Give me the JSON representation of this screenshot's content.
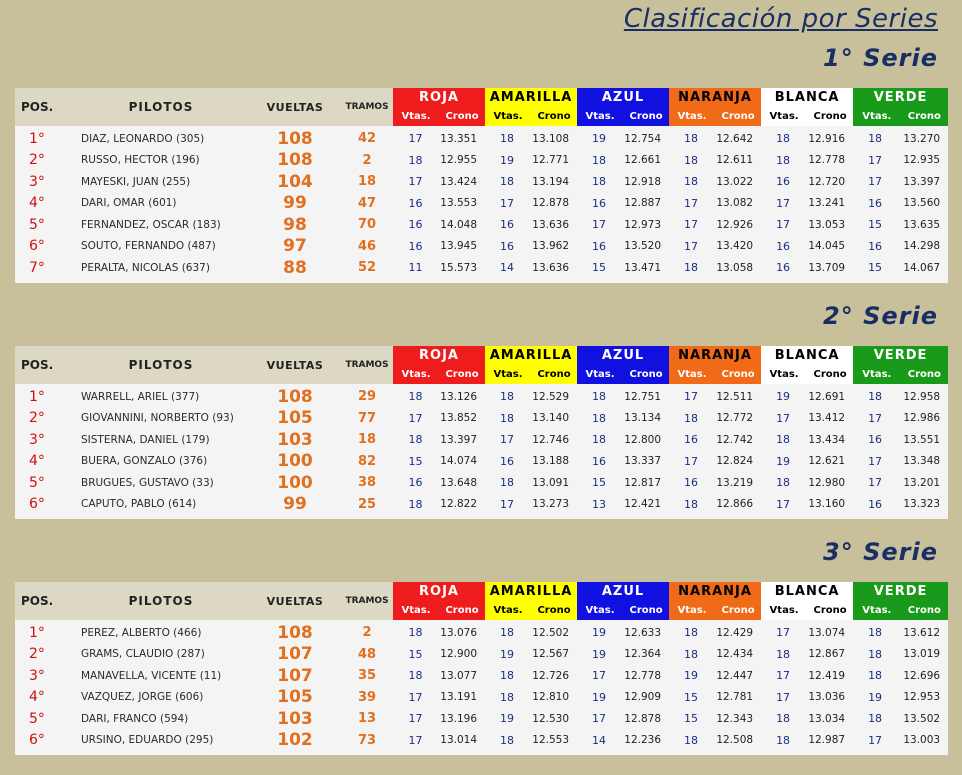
{
  "title": "Clasificación por Series",
  "headers": {
    "pos": "POS.",
    "pilotos": "PILOTOS",
    "vueltas": "VUELTAS",
    "tramos": "TRAMOS",
    "vtas": "Vtas.",
    "crono": "Crono"
  },
  "lanes": [
    {
      "name": "ROJA",
      "bg": "#ee1c1c",
      "fg": "#ffffff",
      "subfg": "#ffffff"
    },
    {
      "name": "AMARILLA",
      "bg": "#ffff00",
      "fg": "#000000",
      "subfg": "#000000"
    },
    {
      "name": "AZUL",
      "bg": "#1010e0",
      "fg": "#ffffff",
      "subfg": "#ffffff"
    },
    {
      "name": "NARANJA",
      "bg": "#f06a18",
      "fg": "#000000",
      "subfg": "#ffffff"
    },
    {
      "name": "BLANCA",
      "bg": "#ffffff",
      "fg": "#000000",
      "subfg": "#000000"
    },
    {
      "name": "VERDE",
      "bg": "#1a9a1a",
      "fg": "#ffffff",
      "subfg": "#ffffff"
    }
  ],
  "series": [
    {
      "title": "1° Serie",
      "rows": [
        {
          "pos": "1°",
          "piloto": "DIAZ, LEONARDO (305)",
          "vueltas": "108",
          "tramos": "42",
          "laps": [
            [
              "17",
              "13.351"
            ],
            [
              "18",
              "13.108"
            ],
            [
              "19",
              "12.754"
            ],
            [
              "18",
              "12.642"
            ],
            [
              "18",
              "12.916"
            ],
            [
              "18",
              "13.270"
            ]
          ]
        },
        {
          "pos": "2°",
          "piloto": "RUSSO, HECTOR (196)",
          "vueltas": "108",
          "tramos": "2",
          "laps": [
            [
              "18",
              "12.955"
            ],
            [
              "19",
              "12.771"
            ],
            [
              "18",
              "12.661"
            ],
            [
              "18",
              "12.611"
            ],
            [
              "18",
              "12.778"
            ],
            [
              "17",
              "12.935"
            ]
          ]
        },
        {
          "pos": "3°",
          "piloto": "MAYESKI, JUAN (255)",
          "vueltas": "104",
          "tramos": "18",
          "laps": [
            [
              "17",
              "13.424"
            ],
            [
              "18",
              "13.194"
            ],
            [
              "18",
              "12.918"
            ],
            [
              "18",
              "13.022"
            ],
            [
              "16",
              "12.720"
            ],
            [
              "17",
              "13.397"
            ]
          ]
        },
        {
          "pos": "4°",
          "piloto": "DARI, OMAR (601)",
          "vueltas": "99",
          "tramos": "47",
          "laps": [
            [
              "16",
              "13.553"
            ],
            [
              "17",
              "12.878"
            ],
            [
              "16",
              "12.887"
            ],
            [
              "17",
              "13.082"
            ],
            [
              "17",
              "13.241"
            ],
            [
              "16",
              "13.560"
            ]
          ]
        },
        {
          "pos": "5°",
          "piloto": "FERNANDEZ, OSCAR (183)",
          "vueltas": "98",
          "tramos": "70",
          "laps": [
            [
              "16",
              "14.048"
            ],
            [
              "16",
              "13.636"
            ],
            [
              "17",
              "12.973"
            ],
            [
              "17",
              "12.926"
            ],
            [
              "17",
              "13.053"
            ],
            [
              "15",
              "13.635"
            ]
          ]
        },
        {
          "pos": "6°",
          "piloto": "SOUTO, FERNANDO  (487)",
          "vueltas": "97",
          "tramos": "46",
          "laps": [
            [
              "16",
              "13.945"
            ],
            [
              "16",
              "13.962"
            ],
            [
              "16",
              "13.520"
            ],
            [
              "17",
              "13.420"
            ],
            [
              "16",
              "14.045"
            ],
            [
              "16",
              "14.298"
            ]
          ]
        },
        {
          "pos": "7°",
          "piloto": "PERALTA, NICOLAS (637)",
          "vueltas": "88",
          "tramos": "52",
          "laps": [
            [
              "11",
              "15.573"
            ],
            [
              "14",
              "13.636"
            ],
            [
              "15",
              "13.471"
            ],
            [
              "18",
              "13.058"
            ],
            [
              "16",
              "13.709"
            ],
            [
              "15",
              "14.067"
            ]
          ]
        }
      ]
    },
    {
      "title": "2° Serie",
      "rows": [
        {
          "pos": "1°",
          "piloto": "WARRELL, ARIEL (377)",
          "vueltas": "108",
          "tramos": "29",
          "laps": [
            [
              "18",
              "13.126"
            ],
            [
              "18",
              "12.529"
            ],
            [
              "18",
              "12.751"
            ],
            [
              "17",
              "12.511"
            ],
            [
              "19",
              "12.691"
            ],
            [
              "18",
              "12.958"
            ]
          ]
        },
        {
          "pos": "2°",
          "piloto": "GIOVANNINI, NORBERTO (93)",
          "vueltas": "105",
          "tramos": "77",
          "laps": [
            [
              "17",
              "13.852"
            ],
            [
              "18",
              "13.140"
            ],
            [
              "18",
              "13.134"
            ],
            [
              "18",
              "12.772"
            ],
            [
              "17",
              "13.412"
            ],
            [
              "17",
              "12.986"
            ]
          ]
        },
        {
          "pos": "3°",
          "piloto": "SISTERNA, DANIEL (179)",
          "vueltas": "103",
          "tramos": "18",
          "laps": [
            [
              "18",
              "13.397"
            ],
            [
              "17",
              "12.746"
            ],
            [
              "18",
              "12.800"
            ],
            [
              "16",
              "12.742"
            ],
            [
              "18",
              "13.434"
            ],
            [
              "16",
              "13.551"
            ]
          ]
        },
        {
          "pos": "4°",
          "piloto": "BUERA, GONZALO (376)",
          "vueltas": "100",
          "tramos": "82",
          "laps": [
            [
              "15",
              "14.074"
            ],
            [
              "16",
              "13.188"
            ],
            [
              "16",
              "13.337"
            ],
            [
              "17",
              "12.824"
            ],
            [
              "19",
              "12.621"
            ],
            [
              "17",
              "13.348"
            ]
          ]
        },
        {
          "pos": "5°",
          "piloto": "BRUGUES, GUSTAVO (33)",
          "vueltas": "100",
          "tramos": "38",
          "laps": [
            [
              "16",
              "13.648"
            ],
            [
              "18",
              "13.091"
            ],
            [
              "15",
              "12.817"
            ],
            [
              "16",
              "13.219"
            ],
            [
              "18",
              "12.980"
            ],
            [
              "17",
              "13.201"
            ]
          ]
        },
        {
          "pos": "6°",
          "piloto": "CAPUTO, PABLO  (614)",
          "vueltas": "99",
          "tramos": "25",
          "laps": [
            [
              "18",
              "12.822"
            ],
            [
              "17",
              "13.273"
            ],
            [
              "13",
              "12.421"
            ],
            [
              "18",
              "12.866"
            ],
            [
              "17",
              "13.160"
            ],
            [
              "16",
              "13.323"
            ]
          ]
        }
      ]
    },
    {
      "title": "3° Serie",
      "rows": [
        {
          "pos": "1°",
          "piloto": "PEREZ, ALBERTO (466)",
          "vueltas": "108",
          "tramos": "2",
          "laps": [
            [
              "18",
              "13.076"
            ],
            [
              "18",
              "12.502"
            ],
            [
              "19",
              "12.633"
            ],
            [
              "18",
              "12.429"
            ],
            [
              "17",
              "13.074"
            ],
            [
              "18",
              "13.612"
            ]
          ]
        },
        {
          "pos": "2°",
          "piloto": "GRAMS, CLAUDIO (287)",
          "vueltas": "107",
          "tramos": "48",
          "laps": [
            [
              "15",
              "12.900"
            ],
            [
              "19",
              "12.567"
            ],
            [
              "19",
              "12.364"
            ],
            [
              "18",
              "12.434"
            ],
            [
              "18",
              "12.867"
            ],
            [
              "18",
              "13.019"
            ]
          ]
        },
        {
          "pos": "3°",
          "piloto": "MANAVELLA, VICENTE (11)",
          "vueltas": "107",
          "tramos": "35",
          "laps": [
            [
              "18",
              "13.077"
            ],
            [
              "18",
              "12.726"
            ],
            [
              "17",
              "12.778"
            ],
            [
              "19",
              "12.447"
            ],
            [
              "17",
              "12.419"
            ],
            [
              "18",
              "12.696"
            ]
          ]
        },
        {
          "pos": "4°",
          "piloto": "VAZQUEZ, JORGE (606)",
          "vueltas": "105",
          "tramos": "39",
          "laps": [
            [
              "17",
              "13.191"
            ],
            [
              "18",
              "12.810"
            ],
            [
              "19",
              "12.909"
            ],
            [
              "15",
              "12.781"
            ],
            [
              "17",
              "13.036"
            ],
            [
              "19",
              "12.953"
            ]
          ]
        },
        {
          "pos": "5°",
          "piloto": "DARI, FRANCO (594)",
          "vueltas": "103",
          "tramos": "13",
          "laps": [
            [
              "17",
              "13.196"
            ],
            [
              "19",
              "12.530"
            ],
            [
              "17",
              "12.878"
            ],
            [
              "15",
              "12.343"
            ],
            [
              "18",
              "13.034"
            ],
            [
              "18",
              "13.502"
            ]
          ]
        },
        {
          "pos": "6°",
          "piloto": "URSINO, EDUARDO (295)",
          "vueltas": "102",
          "tramos": "73",
          "laps": [
            [
              "17",
              "13.014"
            ],
            [
              "18",
              "12.553"
            ],
            [
              "14",
              "12.236"
            ],
            [
              "18",
              "12.508"
            ],
            [
              "18",
              "12.987"
            ],
            [
              "17",
              "13.003"
            ]
          ]
        }
      ]
    }
  ]
}
